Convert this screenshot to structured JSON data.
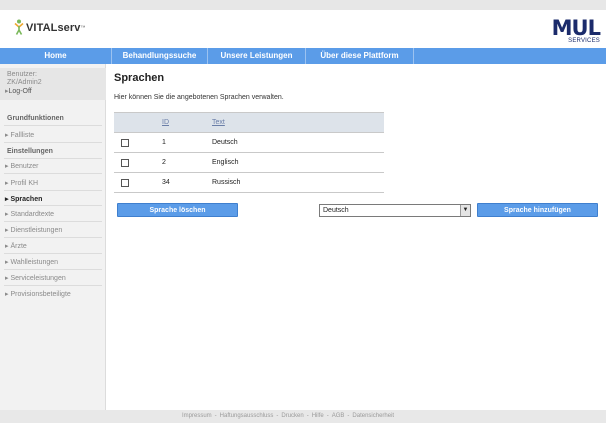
{
  "brand": {
    "vital_name": "VITALserv",
    "vital_tm": "™",
    "mul_word": "MUL",
    "mul_sub": "SERVICES",
    "icon": "person-figure-icon",
    "accent": "#5b9ce8",
    "mul_color": "#1b2b6b"
  },
  "nav": {
    "items": [
      {
        "label": "Home"
      },
      {
        "label": "Behandlungssuche"
      },
      {
        "label": "Unsere Leistungen"
      },
      {
        "label": "Über diese Plattform"
      }
    ]
  },
  "sidebar": {
    "user_label": "Benutzer:",
    "user_name": "ZK/Admin2",
    "logoff": "Log-Off",
    "section_1": "Grundfunktionen",
    "fallliste": "Fallliste",
    "section_2": "Einstellungen",
    "items": [
      {
        "label": "Benutzer"
      },
      {
        "label": "Profil KH"
      },
      {
        "label": "Sprachen"
      },
      {
        "label": "Standardtexte"
      },
      {
        "label": "Dienstleistungen"
      },
      {
        "label": "Ärzte"
      },
      {
        "label": "Wahlleistungen"
      },
      {
        "label": "Serviceleistungen"
      },
      {
        "label": "Provisionsbeteiligte"
      }
    ]
  },
  "main": {
    "title": "Sprachen",
    "subtitle": "Hier können Sie die angebotenen Sprachen verwalten.",
    "table": {
      "columns": [
        "ID",
        "Text"
      ],
      "rows": [
        {
          "id": "1",
          "text": "Deutsch"
        },
        {
          "id": "2",
          "text": "Englisch"
        },
        {
          "id": "34",
          "text": "Russisch"
        }
      ]
    },
    "delete_button": "Sprache löschen",
    "select_value": "Deutsch",
    "add_button": "Sprache hinzufügen"
  },
  "footer": {
    "links": [
      "Impressum",
      "Haftungsausschluss",
      "Drucken",
      "Hilfe",
      "AGB",
      "Datensicherheit"
    ],
    "separator": "-"
  }
}
